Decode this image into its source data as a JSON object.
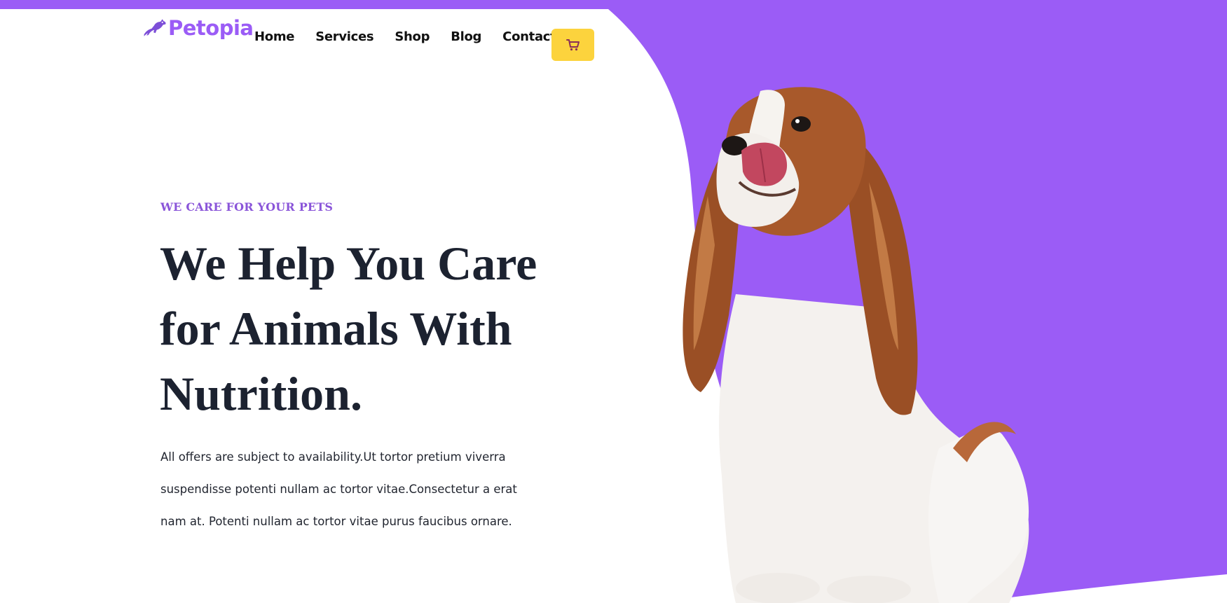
{
  "header": {
    "logo_text": "Petopia",
    "logo_icon": "paw-dog-icon",
    "nav": [
      {
        "label": "Home"
      },
      {
        "label": "Services"
      },
      {
        "label": "Shop"
      },
      {
        "label": "Blog"
      },
      {
        "label": "Contact"
      }
    ],
    "cart_icon": "cart-icon"
  },
  "hero": {
    "eyebrow": "WE CARE FOR YOUR PETS",
    "headline_lines": [
      "We Help You Care",
      "for Animals With",
      "Nutrition."
    ],
    "body_lines": [
      "All offers are subject to availability.Ut tortor pretium viverra",
      "suspendisse potenti nullam ac tortor vitae.Consectetur a erat",
      "nam at. Potenti nullam ac tortor vitae purus faucibus ornare."
    ],
    "image_subject": "dog"
  },
  "colors": {
    "brand_purple": "#9b5cf6",
    "cart_yellow": "#fcd33d",
    "heading_dark": "#1c2230"
  }
}
